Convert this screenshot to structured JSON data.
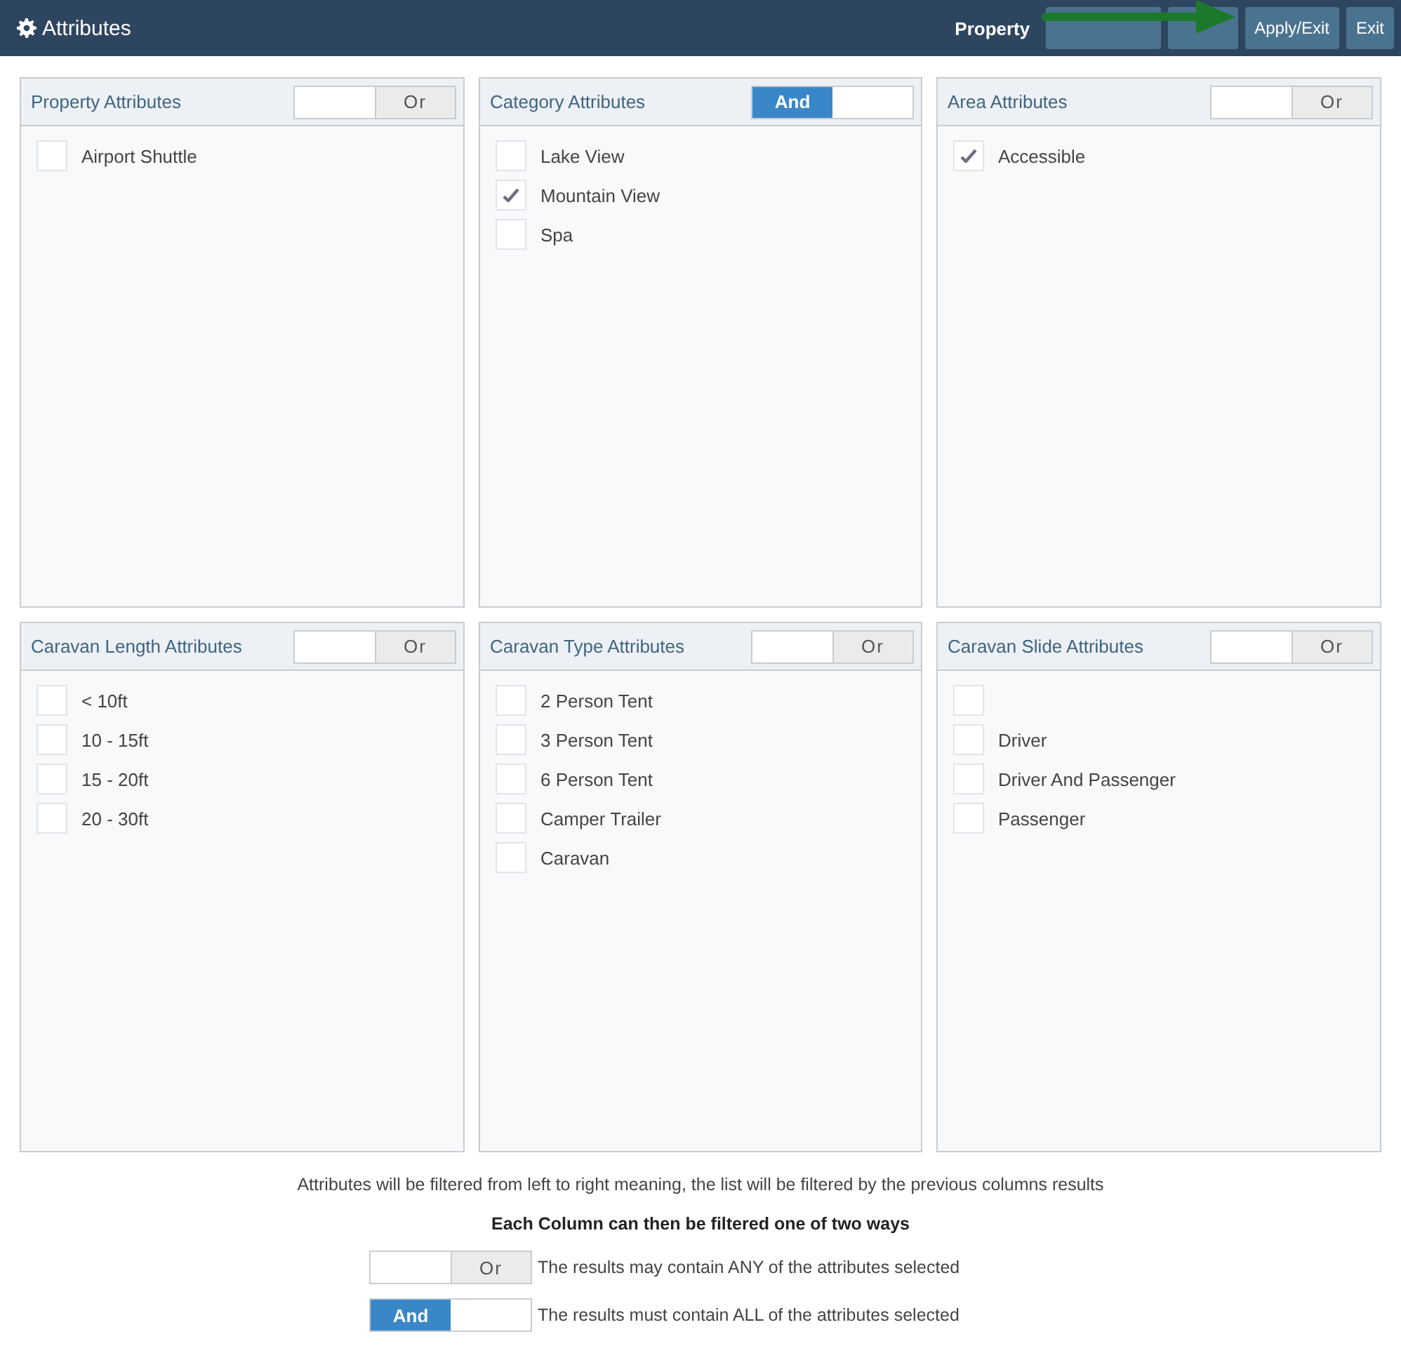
{
  "header": {
    "title": "Attributes",
    "context": "Property",
    "buttons": [
      {
        "kind": "blank"
      },
      {
        "kind": "blank"
      },
      {
        "kind": "text",
        "label": "Apply/Exit"
      },
      {
        "kind": "text",
        "label": "Exit"
      }
    ]
  },
  "panels": [
    {
      "title": "Property Attributes",
      "toggle": {
        "and_selected": false,
        "label": "Or"
      },
      "items": [
        {
          "label": "Airport Shuttle",
          "checked": false
        }
      ]
    },
    {
      "title": "Category Attributes",
      "toggle": {
        "and_selected": true,
        "label": "And"
      },
      "items": [
        {
          "label": "Lake View",
          "checked": false
        },
        {
          "label": "Mountain View",
          "checked": true
        },
        {
          "label": "Spa",
          "checked": false
        }
      ]
    },
    {
      "title": "Area Attributes",
      "toggle": {
        "and_selected": false,
        "label": "Or"
      },
      "items": [
        {
          "label": "Accessible",
          "checked": true
        }
      ]
    },
    {
      "title": "Caravan Length Attributes",
      "toggle": {
        "and_selected": false,
        "label": "Or"
      },
      "items": [
        {
          "label": "< 10ft",
          "checked": false
        },
        {
          "label": "10 - 15ft",
          "checked": false
        },
        {
          "label": "15 - 20ft",
          "checked": false
        },
        {
          "label": "20 - 30ft",
          "checked": false
        }
      ]
    },
    {
      "title": "Caravan Type Attributes",
      "toggle": {
        "and_selected": false,
        "label": "Or"
      },
      "items": [
        {
          "label": "2 Person Tent",
          "checked": false
        },
        {
          "label": "3 Person Tent",
          "checked": false
        },
        {
          "label": "6 Person Tent",
          "checked": false
        },
        {
          "label": "Camper Trailer",
          "checked": false
        },
        {
          "label": "Caravan",
          "checked": false
        }
      ]
    },
    {
      "title": "Caravan Slide Attributes",
      "toggle": {
        "and_selected": false,
        "label": "Or"
      },
      "items": [
        {
          "checked": false
        },
        {
          "label": "Driver",
          "checked": false
        },
        {
          "label": "Driver And Passenger",
          "checked": false
        },
        {
          "label": "Passenger",
          "checked": false
        }
      ]
    }
  ],
  "help": {
    "note": "Attributes will be filtered from left to right meaning, the list will be filtered by the previous columns results",
    "heading": "Each Column can then be filtered one of two ways",
    "legend": [
      {
        "toggle": {
          "and_selected": false,
          "label": "Or"
        },
        "text": "The results may contain ANY of the attributes selected"
      },
      {
        "toggle": {
          "and_selected": true,
          "label": "And"
        },
        "text": "The results must contain ALL of the attributes selected"
      }
    ]
  }
}
